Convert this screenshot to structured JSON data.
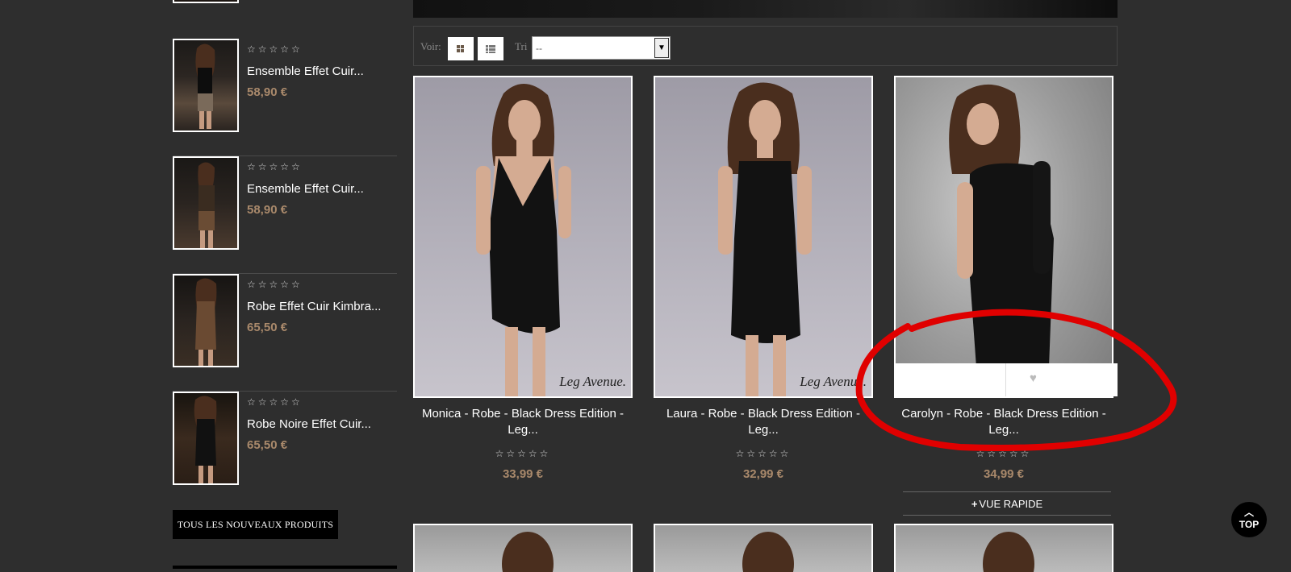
{
  "sidebar": {
    "items": [
      {
        "name": "Ensemble Effet Cuir...",
        "price": "58,90 €",
        "rating": "☆☆☆☆☆"
      },
      {
        "name": "Ensemble Effet Cuir...",
        "price": "58,90 €",
        "rating": "☆☆☆☆☆"
      },
      {
        "name": "Robe Effet Cuir Kimbra...",
        "price": "65,50 €",
        "rating": "☆☆☆☆☆"
      },
      {
        "name": "Robe Noire Effet Cuir...",
        "price": "65,50 €",
        "rating": "☆☆☆☆☆"
      }
    ],
    "all_new_button": "TOUS LES NOUVEAUX PRODUITS"
  },
  "toolbar": {
    "view_label": "Voir:",
    "grid_icon": "grid-view-icon",
    "list_icon": "list-view-icon",
    "sort_label": "Tri",
    "sort_value": "--"
  },
  "products": [
    {
      "name": "Monica - Robe - Black Dress Edition - Leg...",
      "price": "33,99 €",
      "rating": "☆☆☆☆☆",
      "watermark": "Leg Avenue."
    },
    {
      "name": "Laura - Robe - Black Dress Edition - Leg...",
      "price": "32,99 €",
      "rating": "☆☆☆☆☆",
      "watermark": "Leg Avenue."
    },
    {
      "name": "Carolyn - Robe - Black Dress Edition - Leg...",
      "price": "34,99 €",
      "rating": "☆☆☆☆☆"
    }
  ],
  "quick_view": "VUE RAPIDE",
  "wishlist_icon": "heart-icon",
  "top_button": "TOP",
  "colors": {
    "background": "#2e2e2e",
    "price": "#a9896b",
    "highlight": "#e00000"
  }
}
